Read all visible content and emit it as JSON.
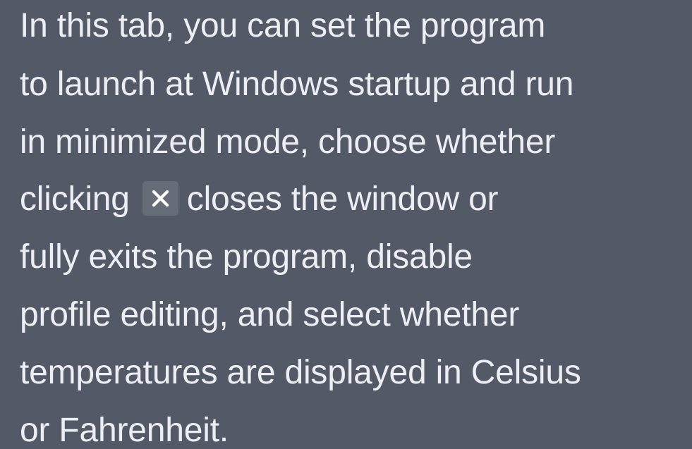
{
  "tooltip": {
    "line1": "In this tab, you can set the program",
    "line2": "to launch at Windows startup and run",
    "line3": "in minimized mode, choose whether",
    "line4_before": "clicking",
    "line4_after": "closes the window or",
    "line5": "fully exits the program, disable",
    "line6": "profile editing, and select whether",
    "line7": "temperatures are displayed in Celsius",
    "line8": "or Fahrenheit.",
    "inline_icon": "close-x-icon"
  },
  "colors": {
    "background": "#545967",
    "text": "#eceef3",
    "icon_chip": "#676c79",
    "icon": "#ffffff"
  }
}
